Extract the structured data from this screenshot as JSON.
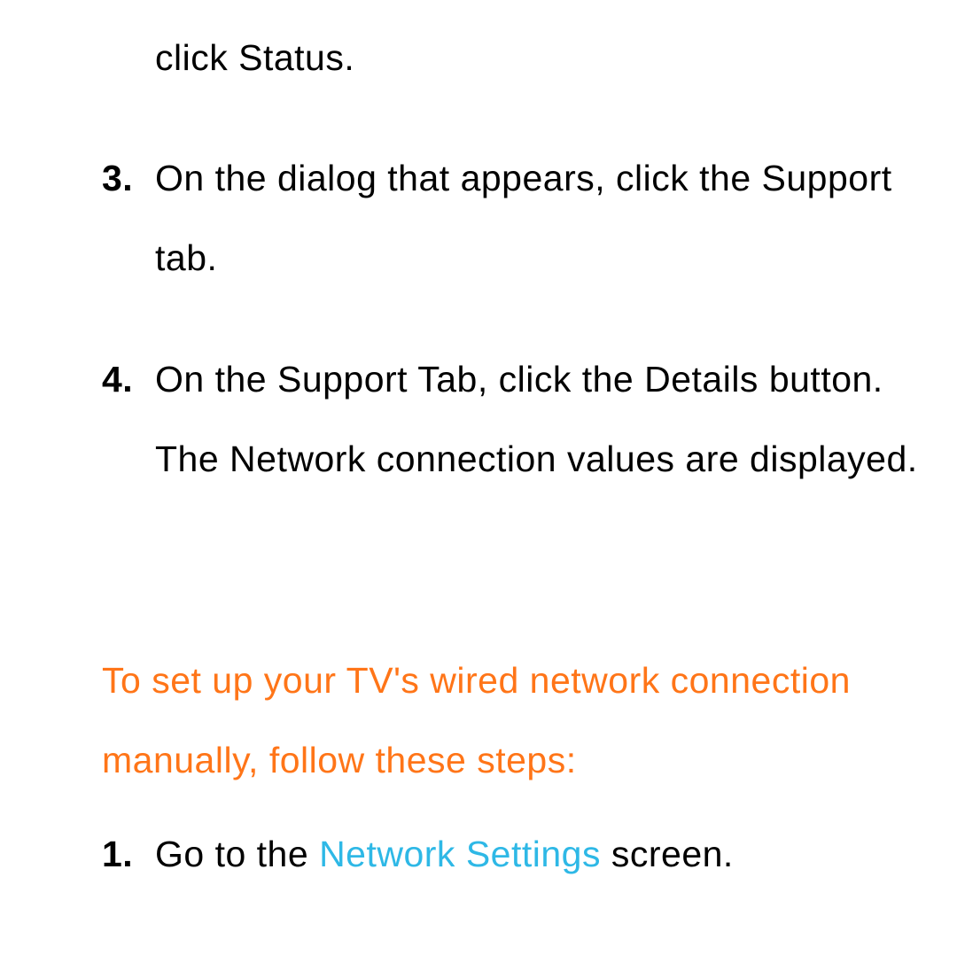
{
  "fragment_prev": "click Status.",
  "items_a": [
    {
      "marker": "3.",
      "text": "On the dialog that appears, click the Support tab."
    },
    {
      "marker": "4.",
      "text": "On the Support Tab, click the Details button. The Network connection values are displayed."
    }
  ],
  "heading": "To set up your TV's wired network connection manually, follow these steps:",
  "items_b": [
    {
      "marker": "1.",
      "pre": "Go to the ",
      "hl": "Network Settings",
      "post": " screen."
    }
  ]
}
